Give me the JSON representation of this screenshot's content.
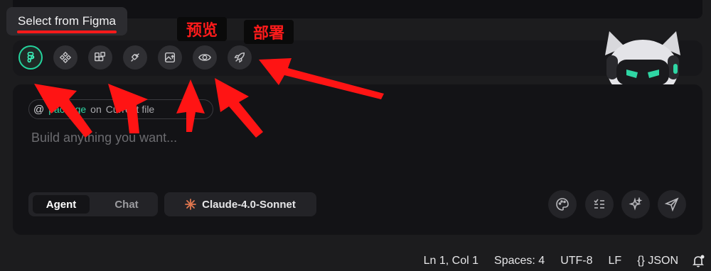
{
  "tooltip": {
    "text": "Select from Figma"
  },
  "callouts": {
    "preview": "预览",
    "deploy": "部署"
  },
  "toolbar": {
    "buttons": [
      {
        "icon": "figma-icon",
        "active": true
      },
      {
        "icon": "component-icon",
        "active": false
      },
      {
        "icon": "blocks-icon",
        "active": false
      },
      {
        "icon": "plug-icon",
        "active": false
      },
      {
        "icon": "image-upload-icon",
        "active": false
      },
      {
        "icon": "eye-icon",
        "active": false
      },
      {
        "icon": "rocket-icon",
        "active": false
      }
    ]
  },
  "context_chip": {
    "name": "package",
    "on": "on",
    "target": "Current file"
  },
  "input": {
    "placeholder": "Build anything you want..."
  },
  "mode": {
    "active": "Agent",
    "inactive": "Chat"
  },
  "model": {
    "name": "Claude-4.0-Sonnet"
  },
  "actions": [
    "palette-icon",
    "checklist-icon",
    "sparkles-icon",
    "send-icon"
  ],
  "status": {
    "position": "Ln 1, Col 1",
    "spaces": "Spaces: 4",
    "encoding": "UTF-8",
    "eol": "LF",
    "language": "{} JSON"
  },
  "colors": {
    "accent": "#2fd6a4",
    "annotation": "#ff1a1a"
  }
}
